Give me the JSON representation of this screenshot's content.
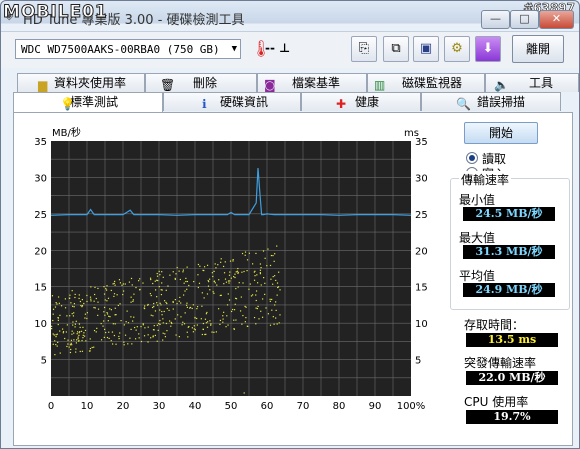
{
  "window": {
    "title": "HD Tune 專業版 3.00 - 硬碟檢測工具",
    "watermark_logo": "MOBILE01",
    "watermark_number": "#63897",
    "controls": {
      "minimize": "—",
      "maximize": "□",
      "close": "✕"
    }
  },
  "toolbar": {
    "drive": "WDC WD7500AAKS-00RBA0 (750 GB)",
    "temperature": "-- ⊥",
    "exit_label": "離開",
    "buttons": [
      "copy-info-icon",
      "copy-screenshot-icon",
      "save-icon",
      "options-icon",
      "download-icon"
    ]
  },
  "tabs_top": [
    {
      "label": "資料夾使用率",
      "icon": "folder-icon"
    },
    {
      "label": "刪除",
      "icon": "trash-icon"
    },
    {
      "label": "檔案基準",
      "icon": "file-benchmark-icon"
    },
    {
      "label": "磁碟監視器",
      "icon": "disk-monitor-icon"
    },
    {
      "label": "工具",
      "icon": "speaker-icon"
    }
  ],
  "tabs_bottom": [
    {
      "label": "標準測試",
      "icon": "bulb-icon",
      "active": true
    },
    {
      "label": "硬碟資訊",
      "icon": "info-icon",
      "active": false
    },
    {
      "label": "健康",
      "icon": "health-cross-icon",
      "active": false
    },
    {
      "label": "錯誤掃描",
      "icon": "magnifier-icon",
      "active": false
    }
  ],
  "side": {
    "start_label": "開始",
    "radio_read": "讀取",
    "radio_write": "寫入",
    "selected_mode": "read",
    "transfer_group_title": "傳輸速率",
    "min_label": "最小值",
    "min_value": "24.5 MB/秒",
    "max_label": "最大值",
    "max_value": "31.3 MB/秒",
    "avg_label": "平均值",
    "avg_value": "24.9 MB/秒",
    "access_label": "存取時間：",
    "access_value": "13.5 ms",
    "burst_label": "突發傳輸速率",
    "burst_value": "22.0 MB/秒",
    "cpu_label": "CPU 使用率",
    "cpu_value": "19.7%"
  },
  "colors": {
    "plot_bg": "#222222",
    "grid": "#6b6b6b",
    "transfer_line": "#3f9fe0",
    "access_points": "#e8e84a",
    "value_bg": "#000000",
    "value_cyan": "#7fd8ff",
    "value_yellow": "#ffef33"
  },
  "chart_data": {
    "type": "line",
    "left_axis_unit": "MB/秒",
    "right_axis_unit": "ms",
    "ylim": [
      0,
      35
    ],
    "y_ticks": [
      5,
      10,
      15,
      20,
      25,
      30,
      35
    ],
    "y_right_ticks": [
      5,
      10,
      15,
      20,
      25,
      30,
      35
    ],
    "xlim": [
      0,
      100
    ],
    "x_ticks": [
      "0",
      "10",
      "20",
      "30",
      "40",
      "50",
      "60",
      "70",
      "80",
      "90",
      "100%"
    ],
    "grid": true,
    "series": [
      {
        "name": "傳輸速率",
        "x": [
          0,
          5,
          10,
          11,
          12,
          15,
          20,
          22,
          23,
          25,
          30,
          35,
          40,
          45,
          49,
          50,
          51,
          55,
          57,
          57.5,
          58,
          58.5,
          59,
          60,
          62,
          65,
          70,
          75,
          80,
          85,
          90,
          95,
          100
        ],
        "values": [
          24.8,
          24.9,
          24.9,
          25.6,
          24.9,
          24.9,
          24.9,
          25.5,
          24.9,
          24.9,
          24.9,
          24.8,
          24.9,
          24.9,
          24.9,
          25.2,
          24.9,
          24.9,
          26.5,
          31.3,
          28.0,
          24.9,
          24.9,
          25.0,
          24.9,
          24.9,
          24.9,
          24.9,
          24.8,
          24.9,
          24.9,
          24.9,
          24.8
        ]
      },
      {
        "name": "存取時間",
        "type": "scatter",
        "x_range": [
          0,
          64
        ],
        "y_range_low": [
          5.5,
          10
        ],
        "y_range_high": [
          14,
          21
        ],
        "mean_ms": 13.5,
        "outlier": [
          53.5,
          0.5
        ]
      }
    ]
  }
}
